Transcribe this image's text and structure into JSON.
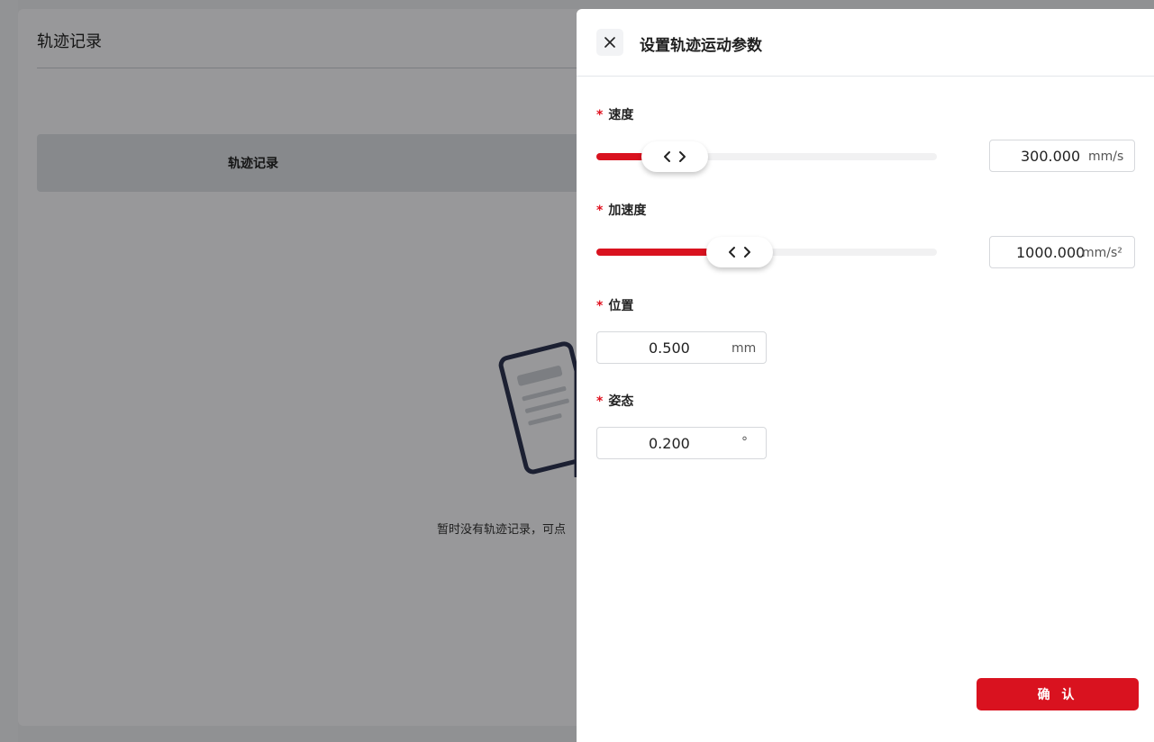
{
  "background": {
    "page_title": "轨迹记录",
    "tab_label": "轨迹记录",
    "empty_text": "暂时没有轨迹记录，可点"
  },
  "drawer": {
    "title": "设置轨迹运动参数",
    "close_icon": "close-icon",
    "fields": {
      "speed": {
        "required_mark": "*",
        "label": "速度",
        "value": "300.000",
        "unit": "mm/s",
        "slider_fraction": 0.23
      },
      "acceleration": {
        "required_mark": "*",
        "label": "加速度",
        "value": "1000.000",
        "unit": "mm/s²",
        "slider_fraction": 0.42
      },
      "position": {
        "required_mark": "*",
        "label": "位置",
        "value": "0.500",
        "unit": "mm"
      },
      "posture": {
        "required_mark": "*",
        "label": "姿态",
        "value": "0.200",
        "unit": "°"
      }
    },
    "confirm_label": "确 认"
  },
  "colors": {
    "accent": "#d9121f",
    "required": "#e0101e"
  }
}
